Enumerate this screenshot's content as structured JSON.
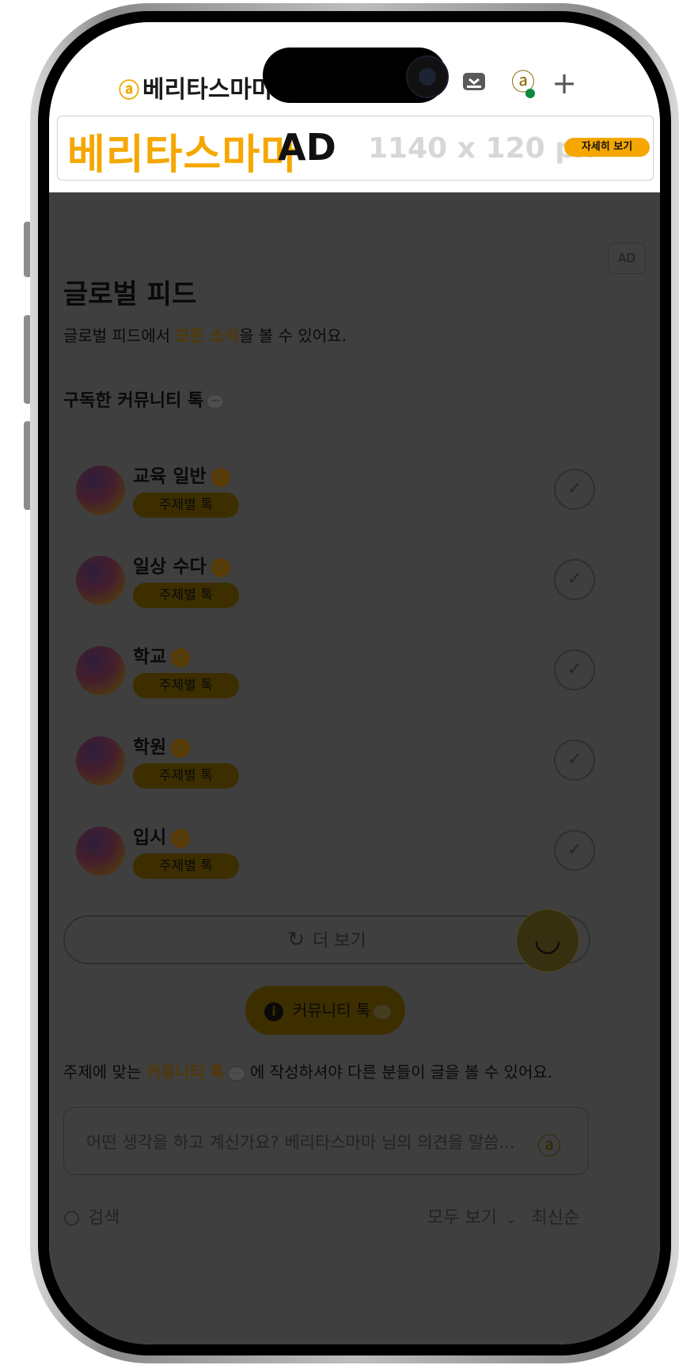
{
  "header": {
    "logo_mark": "ⓐ",
    "logo_text": "베리타스마마",
    "icons": [
      "document-icon",
      "inbox-icon",
      "profile-icon",
      "plus-icon"
    ]
  },
  "ad_banner": {
    "brand": "베리타스마마",
    "ad": "AD",
    "size": "1140 x 120 px",
    "more": "자세히 보기"
  },
  "ad_chip": "AD",
  "feed": {
    "title": "글로벌 피드",
    "subtitle_prefix": "글로벌 피드에서 ",
    "subtitle_highlight": "모든 소식",
    "subtitle_suffix": "을 볼 수 있어요."
  },
  "subscribed": {
    "heading": "구독한 커뮤니티 톡",
    "items": [
      {
        "name": "교육 일반",
        "tag": "주제별 톡"
      },
      {
        "name": "일상 수다",
        "tag": "주제별 톡"
      },
      {
        "name": "학교",
        "tag": "주제별 톡"
      },
      {
        "name": "학원",
        "tag": "주제별 톡"
      },
      {
        "name": "입시",
        "tag": "주제별 톡"
      }
    ]
  },
  "more_button": "더 보기",
  "community_button": "커뮤니티 톡",
  "note": {
    "prefix": "주제에 맞는 ",
    "highlight": "커뮤니티 톡",
    "suffix": " 에 작성하셔야 다른 분들이 글을 볼 수 있어요."
  },
  "compose": {
    "placeholder": "어떤 생각을 하고 계신가요? 베리타스마마 님의 의견을 말씀..."
  },
  "bottom": {
    "search": "검색",
    "filter": "모두 보기",
    "sort": "최신순"
  },
  "colors": {
    "accent": "#f5a700",
    "dim_overlay": "rgba(0,0,0,0.5)"
  }
}
